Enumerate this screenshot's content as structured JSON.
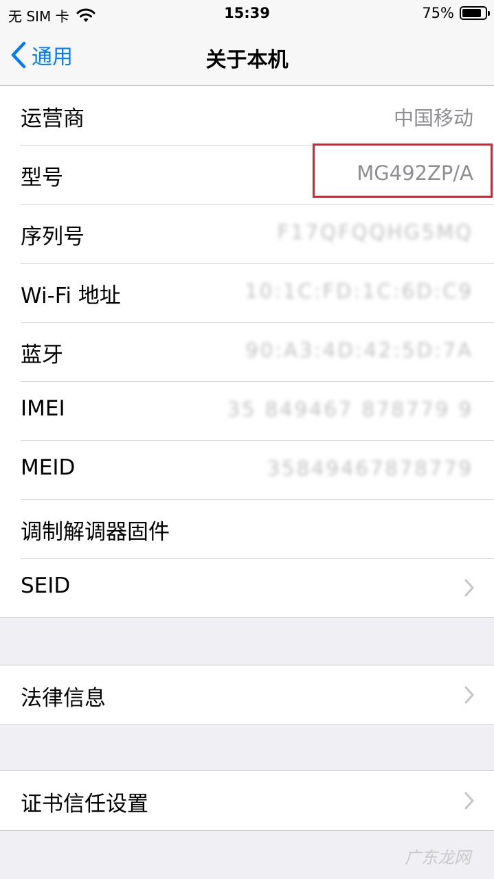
{
  "status_bar": {
    "carrier": "无 SIM 卡",
    "time": "15:39",
    "battery": "75%",
    "battery_level": 0.75
  },
  "nav": {
    "back_label": "通用",
    "title": "关于本机"
  },
  "about_rows": [
    {
      "label": "运营商",
      "value": "中国移动"
    },
    {
      "label": "型号",
      "value": "MG492ZP/A"
    },
    {
      "label": "序列号",
      "value": "F17QFQQHG5MQ"
    },
    {
      "label": "Wi-Fi 地址",
      "value": "10:1C:FD:1C:6D:C9"
    },
    {
      "label": "蓝牙",
      "value": "90:A3:4D:42:5D:7A"
    },
    {
      "label": "IMEI",
      "value": "35 849467 878779 9"
    },
    {
      "label": "MEID",
      "value": "35849467878779"
    },
    {
      "label": "调制解调器固件",
      "value": ""
    },
    {
      "label": "SEID",
      "value": ""
    }
  ],
  "legal": {
    "label": "法律信息"
  },
  "certs": {
    "label": "证书信任设置"
  },
  "watermark": "广东龙网",
  "colors": {
    "accent": "#007aff",
    "highlight": "#d9232d",
    "background": "#efeff4"
  }
}
